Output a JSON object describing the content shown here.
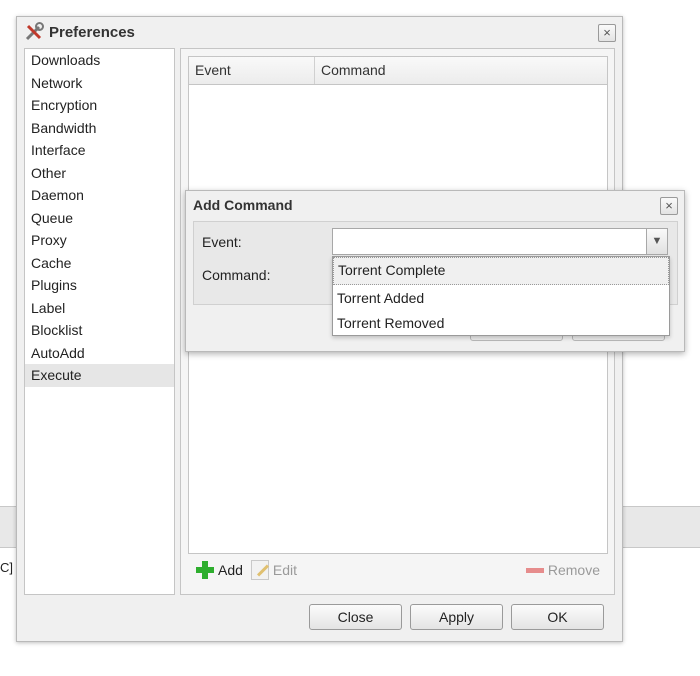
{
  "background": {
    "fragment_text": "C]"
  },
  "window": {
    "title": "Preferences",
    "icon": "wrench-screwdriver-icon",
    "close_symbol": "×"
  },
  "sidebar": {
    "items": [
      {
        "label": "Downloads"
      },
      {
        "label": "Network"
      },
      {
        "label": "Encryption"
      },
      {
        "label": "Bandwidth"
      },
      {
        "label": "Interface"
      },
      {
        "label": "Other"
      },
      {
        "label": "Daemon"
      },
      {
        "label": "Queue"
      },
      {
        "label": "Proxy"
      },
      {
        "label": "Cache"
      },
      {
        "label": "Plugins"
      },
      {
        "label": "Label"
      },
      {
        "label": "Blocklist"
      },
      {
        "label": "AutoAdd"
      },
      {
        "label": "Execute"
      }
    ],
    "selected": "Execute"
  },
  "grid": {
    "columns": [
      "Event",
      "Command"
    ],
    "rows": []
  },
  "toolbar": {
    "add_label": "Add",
    "edit_label": "Edit",
    "remove_label": "Remove"
  },
  "footer": {
    "close_label": "Close",
    "apply_label": "Apply",
    "ok_label": "OK"
  },
  "dialog": {
    "title": "Add Command",
    "close_symbol": "×",
    "event_label": "Event:",
    "command_label": "Command:",
    "event_value": "",
    "trigger_symbol": "▼",
    "dropdown_options": [
      "Torrent Complete",
      "Torrent Added",
      "Torrent Removed"
    ],
    "highlighted_option": "Torrent Complete"
  },
  "colors": {
    "add_icon": "#2eae2e",
    "remove_icon": "#e06060",
    "selection": "#e6e6e6"
  }
}
